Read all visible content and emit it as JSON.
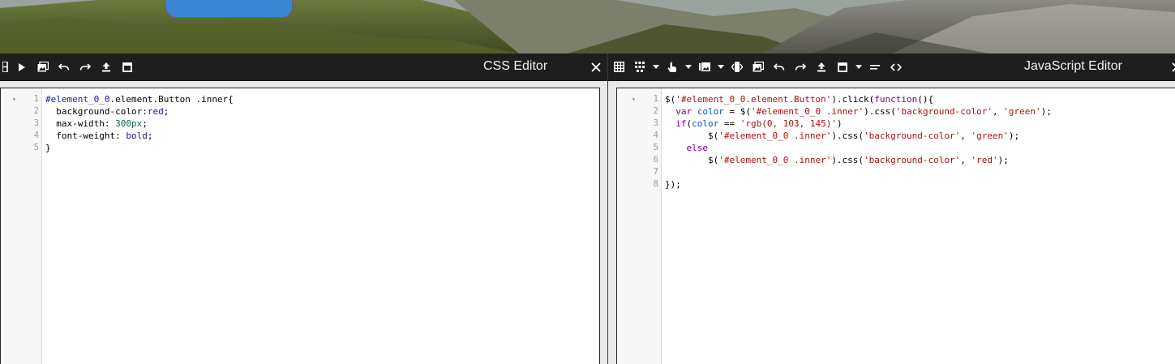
{
  "css_editor": {
    "title": "CSS Editor",
    "toolbar": [
      "grid-icon",
      "run-icon",
      "image-icon",
      "undo-icon",
      "redo-icon",
      "upload-icon",
      "window-icon"
    ],
    "lines": [
      [
        {
          "t": "#element_0_0",
          "c": "t-sel"
        },
        {
          "t": ".element.Button .inner{",
          "c": "t-plain"
        }
      ],
      [
        {
          "t": "  background-color:",
          "c": "t-prop"
        },
        {
          "t": "red",
          "c": "t-atom"
        },
        {
          "t": ";",
          "c": "t-plain"
        }
      ],
      [
        {
          "t": "  max-width: ",
          "c": "t-prop"
        },
        {
          "t": "300px",
          "c": "t-num"
        },
        {
          "t": ";",
          "c": "t-plain"
        }
      ],
      [
        {
          "t": "  font-weight: ",
          "c": "t-prop"
        },
        {
          "t": "bold",
          "c": "t-atom"
        },
        {
          "t": ";",
          "c": "t-plain"
        }
      ],
      [
        {
          "t": "}",
          "c": "t-plain"
        }
      ]
    ]
  },
  "js_editor": {
    "title": "JavaScript Editor",
    "toolbar": [
      "table-icon",
      "dots-grid-icon",
      "caret-icon",
      "hand-icon",
      "caret-icon",
      "gallery-icon",
      "caret-icon",
      "code-block-icon",
      "image-icon",
      "undo-icon",
      "redo-icon",
      "upload-icon",
      "window-icon",
      "caret-icon",
      "equals-icon",
      "brackets-icon"
    ],
    "lines": [
      [
        {
          "t": "$(",
          "c": "t-plain"
        },
        {
          "t": "'#element_0_0.element.Button'",
          "c": "t-str"
        },
        {
          "t": ").click(",
          "c": "t-plain"
        },
        {
          "t": "function",
          "c": "t-kw"
        },
        {
          "t": "(){",
          "c": "t-plain"
        }
      ],
      [
        {
          "t": "  ",
          "c": "t-plain"
        },
        {
          "t": "var",
          "c": "t-kw"
        },
        {
          "t": " ",
          "c": "t-plain"
        },
        {
          "t": "color",
          "c": "t-var"
        },
        {
          "t": " = $(",
          "c": "t-plain"
        },
        {
          "t": "'#element_0_0 .inner'",
          "c": "t-str"
        },
        {
          "t": ").css(",
          "c": "t-plain"
        },
        {
          "t": "'background-color'",
          "c": "t-str"
        },
        {
          "t": ", ",
          "c": "t-plain"
        },
        {
          "t": "'green'",
          "c": "t-str"
        },
        {
          "t": ");",
          "c": "t-plain"
        }
      ],
      [
        {
          "t": "  ",
          "c": "t-plain"
        },
        {
          "t": "if",
          "c": "t-kw"
        },
        {
          "t": "(",
          "c": "t-plain"
        },
        {
          "t": "color",
          "c": "t-var"
        },
        {
          "t": " == ",
          "c": "t-plain"
        },
        {
          "t": "'rgb(0, 103, 145)'",
          "c": "t-str"
        },
        {
          "t": ")",
          "c": "t-plain"
        }
      ],
      [
        {
          "t": "        $(",
          "c": "t-plain"
        },
        {
          "t": "'#element_0_0 .inner'",
          "c": "t-str"
        },
        {
          "t": ").css(",
          "c": "t-plain"
        },
        {
          "t": "'background-color'",
          "c": "t-str"
        },
        {
          "t": ", ",
          "c": "t-plain"
        },
        {
          "t": "'green'",
          "c": "t-str"
        },
        {
          "t": ");",
          "c": "t-plain"
        }
      ],
      [
        {
          "t": "    ",
          "c": "t-plain"
        },
        {
          "t": "else",
          "c": "t-kw"
        }
      ],
      [
        {
          "t": "        $(",
          "c": "t-plain"
        },
        {
          "t": "'#element_0_0 .inner'",
          "c": "t-str"
        },
        {
          "t": ").css(",
          "c": "t-plain"
        },
        {
          "t": "'background-color'",
          "c": "t-str"
        },
        {
          "t": ", ",
          "c": "t-plain"
        },
        {
          "t": "'red'",
          "c": "t-str"
        },
        {
          "t": ");",
          "c": "t-plain"
        }
      ],
      [
        {
          "t": "",
          "c": "t-plain"
        }
      ],
      [
        {
          "t": "});",
          "c": "t-plain"
        }
      ]
    ]
  },
  "colors": {
    "toolbar_bg": "#1e1e1e",
    "preview_button": "#3a86d4",
    "gutter_bg": "#f7f7f7"
  }
}
